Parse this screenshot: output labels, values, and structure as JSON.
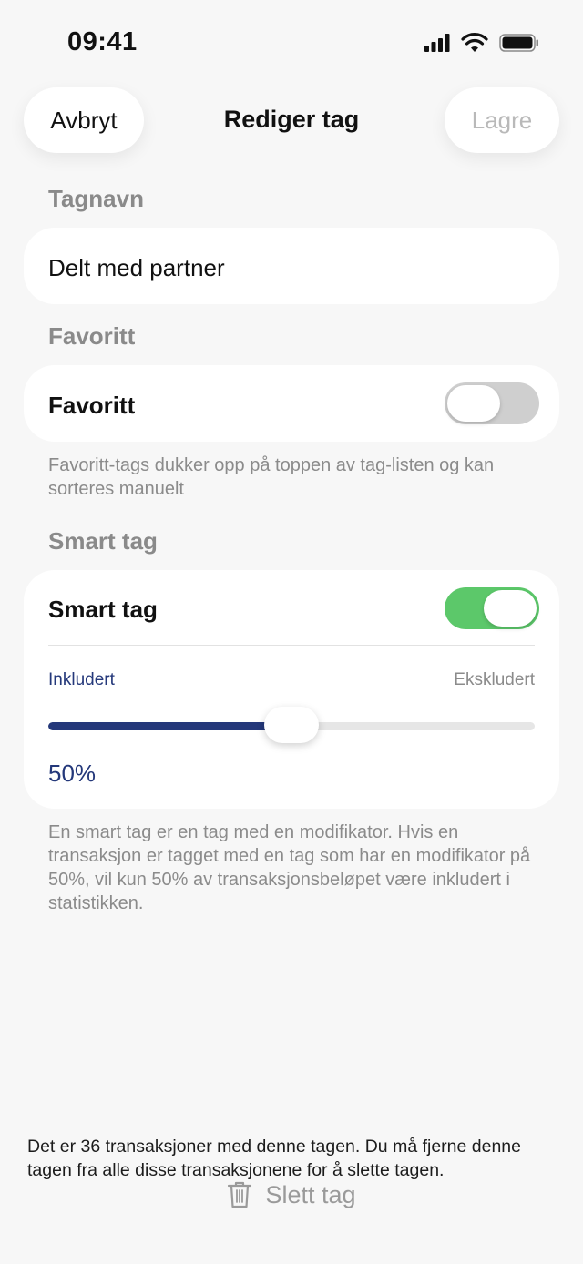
{
  "status": {
    "time": "09:41"
  },
  "nav": {
    "cancel": "Avbryt",
    "title": "Rediger tag",
    "save": "Lagre"
  },
  "name_section": {
    "label": "Tagnavn",
    "value": "Delt med partner"
  },
  "favorite_section": {
    "label": "Favoritt",
    "row_label": "Favoritt",
    "enabled": false,
    "note": "Favoritt-tags dukker opp på toppen av tag-listen og kan sorteres manuelt"
  },
  "smart_section": {
    "label": "Smart tag",
    "row_label": "Smart tag",
    "enabled": true,
    "left_label": "Inkludert",
    "right_label": "Ekskludert",
    "value_percent": 50,
    "value_text": "50%",
    "note": "En smart tag er en tag med en modifikator. Hvis en transaksjon er tagget med en tag som har en modifikator på 50%, vil kun 50% av transaksjonsbeløpet være inkludert i statistikken."
  },
  "footer": {
    "note": "Det er 36 transaksjoner med denne tagen. Du må fjerne denne tagen fra alle disse transaksjonene for å slette tagen.",
    "delete_label": "Slett tag"
  },
  "colors": {
    "accent": "#24387a",
    "toggle_on": "#5cc86a",
    "toggle_off": "#cfcfcf",
    "muted": "#8a8a8a"
  },
  "icons": {
    "delete": "trash-icon",
    "signal": "cellular-signal-icon",
    "wifi": "wifi-icon",
    "battery": "battery-icon"
  }
}
